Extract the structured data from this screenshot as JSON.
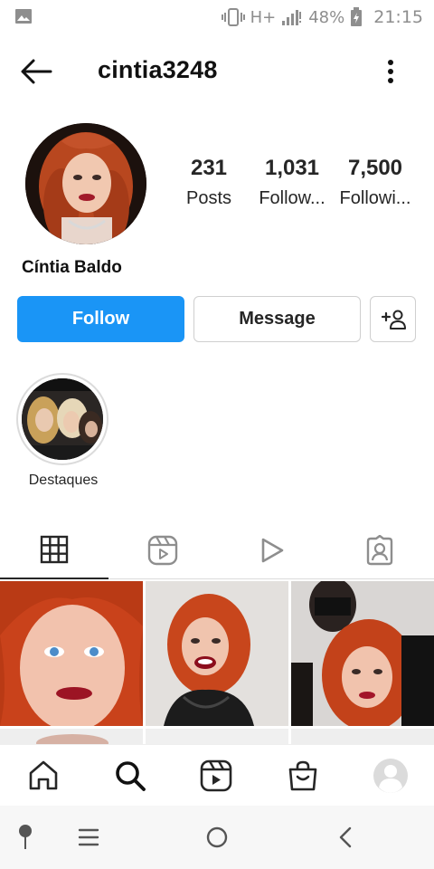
{
  "status_bar": {
    "network": "H+",
    "battery": "48%",
    "time": "21:15"
  },
  "header": {
    "username": "cintia3248"
  },
  "profile": {
    "full_name": "Cíntia Baldo",
    "stats": [
      {
        "count": "231",
        "label": "Posts"
      },
      {
        "count": "1,031",
        "label": "Follow..."
      },
      {
        "count": "7,500",
        "label": "Followi..."
      }
    ]
  },
  "actions": {
    "follow": "Follow",
    "message": "Message"
  },
  "highlights": [
    {
      "label": "Destaques"
    }
  ],
  "tabs": [
    "grid-icon",
    "reels-icon",
    "video-play-icon",
    "tagged-icon"
  ],
  "bottom_nav": [
    "home-icon",
    "search-icon",
    "reels-icon",
    "shop-icon",
    "profile-avatar"
  ],
  "colors": {
    "accent": "#1a95f6",
    "text": "#262626",
    "border": "#dbdbdb"
  }
}
